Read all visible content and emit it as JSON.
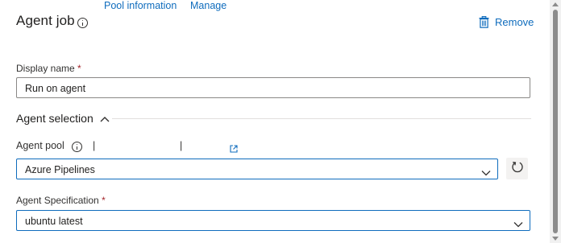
{
  "header": {
    "title": "Agent job",
    "remove_label": "Remove"
  },
  "display_name": {
    "label": "Display name",
    "required_mark": "*",
    "value": "Run on agent"
  },
  "agent_selection": {
    "title": "Agent selection"
  },
  "agent_pool": {
    "label": "Agent pool",
    "separator": "|",
    "pool_information_link": "Pool information",
    "manage_link": "Manage",
    "selected": "Azure Pipelines"
  },
  "agent_specification": {
    "label": "Agent Specification",
    "required_mark": "*",
    "selected": "ubuntu latest"
  },
  "colors": {
    "accent": "#0f6cbd",
    "required": "#a4262c",
    "text": "#201f1e",
    "border": "#8a8886"
  },
  "icons": {
    "info": "info-icon",
    "remove": "trash-icon",
    "collapse": "chevron-up-icon",
    "external": "external-link-icon",
    "dropdown": "chevron-down-icon",
    "refresh": "refresh-icon"
  }
}
